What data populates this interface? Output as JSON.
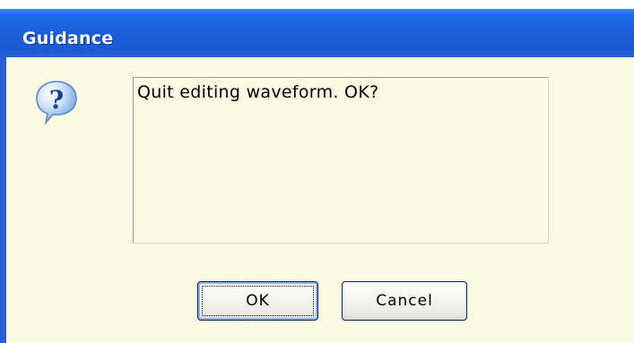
{
  "dialog": {
    "title": "Guidance",
    "message": "Quit editing waveform. OK?",
    "icon": "question-icon",
    "colors": {
      "titlebar": "#1b5bd4",
      "background": "#fbfbe4",
      "border": "#2a5fd7"
    }
  },
  "buttons": {
    "ok_label": "OK",
    "cancel_label": "Cancel"
  }
}
